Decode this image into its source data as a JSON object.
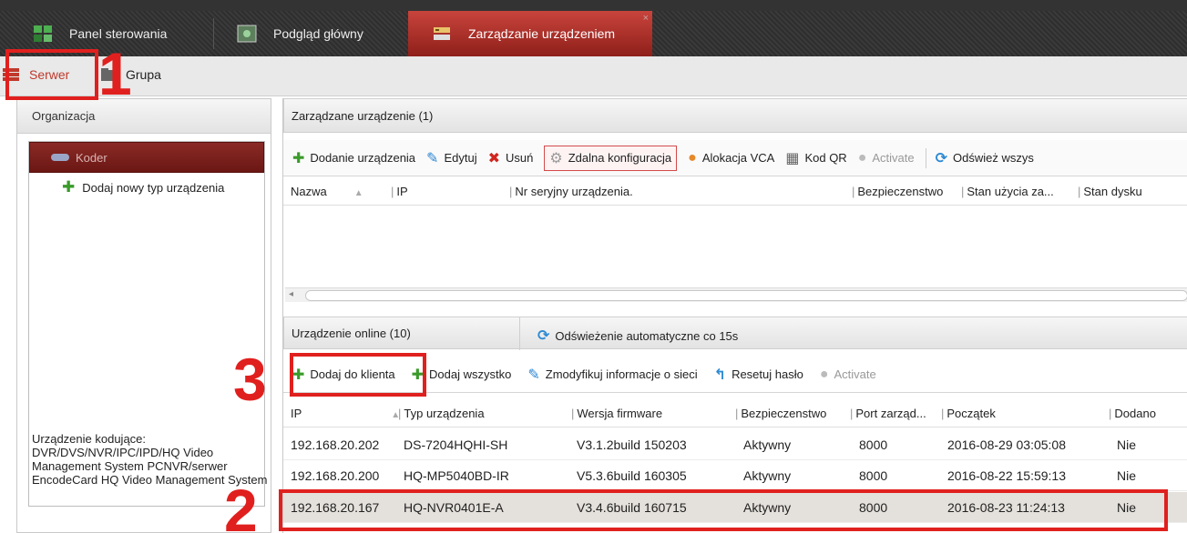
{
  "nav": {
    "tabs": [
      {
        "label": "Panel sterowania",
        "icon": "control-panel-icon"
      },
      {
        "label": "Podgląd główny",
        "icon": "live-view-icon"
      },
      {
        "label": "Zarządzanie urządzeniem",
        "icon": "device-management-icon",
        "active": true
      }
    ],
    "close_glyph": "×"
  },
  "subnav": {
    "serwer": "Serwer",
    "grupa": "Grupa"
  },
  "left": {
    "title": "Organizacja",
    "selected_item": "Koder",
    "add_type": "Dodaj nowy typ urządzenia",
    "description": "Urządzenie kodujące: DVR/DVS/NVR/IPC/IPD/HQ Video Management System PCNVR/serwer EncodeCard HQ Video Management System"
  },
  "managed": {
    "title": "Zarządzane urządzenie (1)",
    "toolbar": {
      "add": "Dodanie urządzenia",
      "edit": "Edytuj",
      "delete": "Usuń",
      "remote": "Zdalna konfiguracja",
      "vca": "Alokacja VCA",
      "qr": "Kod QR",
      "activate": "Activate",
      "refresh": "Odśwież wszys"
    },
    "columns": {
      "name": "Nazwa",
      "ip": "IP",
      "serial": "Nr seryjny urządzenia.",
      "security": "Bezpieczenstwo",
      "usage": "Stan użycia za...",
      "disk": "Stan dysku"
    }
  },
  "online": {
    "title": "Urządzenie online (10)",
    "auto_refresh": "Odświeżenie automatyczne co 15s",
    "toolbar": {
      "add_client": "Dodaj do klienta",
      "add_all": "Dodaj wszystko",
      "modify_net": "Zmodyfikuj informacje o sieci",
      "reset_pwd": "Resetuj hasło",
      "activate": "Activate"
    },
    "columns": {
      "ip": "IP",
      "type": "Typ urządzenia",
      "firmware": "Wersja firmware",
      "security": "Bezpieczenstwo",
      "port": "Port zarząd...",
      "start": "Początek",
      "added": "Dodano"
    },
    "rows": [
      {
        "ip": "192.168.20.202",
        "type": "DS-7204HQHI-SH",
        "firmware": "V3.1.2build 150203",
        "security": "Aktywny",
        "port": "8000",
        "start": "2016-08-29 03:05:08",
        "added": "Nie"
      },
      {
        "ip": "192.168.20.200",
        "type": "HQ-MP5040BD-IR",
        "firmware": "V5.3.6build 160305",
        "security": "Aktywny",
        "port": "8000",
        "start": "2016-08-22 15:59:13",
        "added": "Nie"
      },
      {
        "ip": "192.168.20.167",
        "type": "HQ-NVR0401E-A",
        "firmware": "V3.4.6build 160715",
        "security": "Aktywny",
        "port": "8000",
        "start": "2016-08-23 11:24:13",
        "added": "Nie",
        "selected": true
      }
    ]
  },
  "annotations": {
    "step1": "1",
    "step2": "2",
    "step3": "3"
  },
  "colors": {
    "accent_red": "#e0201e",
    "tab_active": "#b0332c",
    "tree_selected": "#7a211d"
  }
}
